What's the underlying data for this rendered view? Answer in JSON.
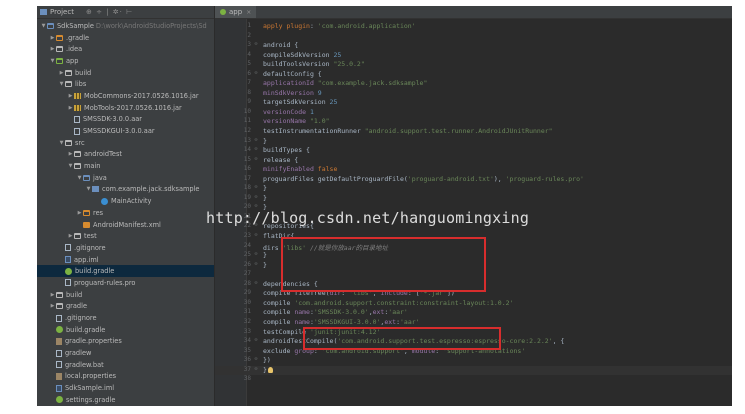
{
  "project_panel": {
    "title": "Project",
    "toolbar_glyphs": "⊕ ÷ | ✲· ⊢",
    "tree": [
      {
        "depth": 0,
        "arrow": "▼",
        "icon": "folder-blue",
        "label": "SdkSample",
        "note": "D:\\work\\AndroidStudioProjects\\Sd"
      },
      {
        "depth": 1,
        "arrow": "▶",
        "icon": "folder-orange",
        "label": ".gradle"
      },
      {
        "depth": 1,
        "arrow": "▶",
        "icon": "folder",
        "label": ".idea"
      },
      {
        "depth": 1,
        "arrow": "▼",
        "icon": "folder-green",
        "label": "app"
      },
      {
        "depth": 2,
        "arrow": "▶",
        "icon": "folder",
        "label": "build"
      },
      {
        "depth": 2,
        "arrow": "▼",
        "icon": "folder",
        "label": "libs"
      },
      {
        "depth": 3,
        "arrow": "▶",
        "icon": "jar",
        "label": "MobCommons-2017.0526.1016.jar"
      },
      {
        "depth": 3,
        "arrow": "▶",
        "icon": "jar",
        "label": "MobTools-2017.0526.1016.jar"
      },
      {
        "depth": 3,
        "arrow": "",
        "icon": "file",
        "label": "SMSSDK-3.0.0.aar"
      },
      {
        "depth": 3,
        "arrow": "",
        "icon": "file",
        "label": "SMSSDKGUI-3.0.0.aar"
      },
      {
        "depth": 2,
        "arrow": "▼",
        "icon": "folder",
        "label": "src"
      },
      {
        "depth": 3,
        "arrow": "▶",
        "icon": "folder",
        "label": "androidTest"
      },
      {
        "depth": 3,
        "arrow": "▼",
        "icon": "folder",
        "label": "main"
      },
      {
        "depth": 4,
        "arrow": "▼",
        "icon": "folder-blue",
        "label": "java"
      },
      {
        "depth": 5,
        "arrow": "▼",
        "icon": "pkg",
        "label": "com.example.jack.sdksample"
      },
      {
        "depth": 6,
        "arrow": "",
        "icon": "cls",
        "label": "MainActivity"
      },
      {
        "depth": 4,
        "arrow": "▶",
        "icon": "folder-orange",
        "label": "res"
      },
      {
        "depth": 4,
        "arrow": "",
        "icon": "xml",
        "label": "AndroidManifest.xml"
      },
      {
        "depth": 3,
        "arrow": "▶",
        "icon": "folder",
        "label": "test"
      },
      {
        "depth": 2,
        "arrow": "",
        "icon": "file",
        "label": ".gitignore"
      },
      {
        "depth": 2,
        "arrow": "",
        "icon": "iml",
        "label": "app.iml"
      },
      {
        "depth": 2,
        "arrow": "",
        "icon": "gradle",
        "label": "build.gradle",
        "selected": true
      },
      {
        "depth": 2,
        "arrow": "",
        "icon": "file",
        "label": "proguard-rules.pro"
      },
      {
        "depth": 1,
        "arrow": "▶",
        "icon": "folder",
        "label": "build"
      },
      {
        "depth": 1,
        "arrow": "▶",
        "icon": "folder",
        "label": "gradle"
      },
      {
        "depth": 1,
        "arrow": "",
        "icon": "file",
        "label": ".gitignore"
      },
      {
        "depth": 1,
        "arrow": "",
        "icon": "gradle",
        "label": "build.gradle"
      },
      {
        "depth": 1,
        "arrow": "",
        "icon": "props",
        "label": "gradle.properties"
      },
      {
        "depth": 1,
        "arrow": "",
        "icon": "file",
        "label": "gradlew"
      },
      {
        "depth": 1,
        "arrow": "",
        "icon": "file",
        "label": "gradlew.bat"
      },
      {
        "depth": 1,
        "arrow": "",
        "icon": "props",
        "label": "local.properties"
      },
      {
        "depth": 1,
        "arrow": "",
        "icon": "iml",
        "label": "SdkSample.iml"
      },
      {
        "depth": 1,
        "arrow": "",
        "icon": "gradle",
        "label": "settings.gradle"
      }
    ]
  },
  "editor": {
    "tab_label": "app",
    "tab_close": "×",
    "lines": [
      {
        "n": "1",
        "code": [
          [
            "k",
            "apply plugin"
          ],
          [
            "d",
            ": "
          ],
          [
            "s",
            "'com.android.application'"
          ]
        ]
      },
      {
        "n": "2",
        "code": []
      },
      {
        "n": "3",
        "fold": "⊖",
        "code": [
          [
            "d",
            "android {"
          ]
        ]
      },
      {
        "n": "4",
        "code": [
          [
            "d",
            "    compileSdkVersion "
          ],
          [
            "n",
            "25"
          ]
        ]
      },
      {
        "n": "5",
        "code": [
          [
            "d",
            "    buildToolsVersion "
          ],
          [
            "s",
            "\"25.0.2\""
          ]
        ]
      },
      {
        "n": "6",
        "fold": "⊖",
        "code": [
          [
            "d",
            "    defaultConfig {"
          ]
        ]
      },
      {
        "n": "7",
        "code": [
          [
            "p",
            "        applicationId "
          ],
          [
            "s",
            "\"com.example.jack.sdksample\""
          ]
        ]
      },
      {
        "n": "8",
        "code": [
          [
            "p",
            "        minSdkVersion "
          ],
          [
            "n",
            "9"
          ]
        ]
      },
      {
        "n": "9",
        "code": [
          [
            "d",
            "        targetSdkVersion "
          ],
          [
            "n",
            "25"
          ]
        ]
      },
      {
        "n": "10",
        "code": [
          [
            "p",
            "        versionCode "
          ],
          [
            "n",
            "1"
          ]
        ]
      },
      {
        "n": "11",
        "code": [
          [
            "p",
            "        versionName "
          ],
          [
            "s",
            "\"1.0\""
          ]
        ]
      },
      {
        "n": "12",
        "code": [
          [
            "d",
            "        testInstrumentationRunner "
          ],
          [
            "s",
            "\"android.support.test.runner.AndroidJUnitRunner\""
          ]
        ]
      },
      {
        "n": "13",
        "fold": "⊖",
        "code": [
          [
            "d",
            "    }"
          ]
        ]
      },
      {
        "n": "14",
        "fold": "⊖",
        "code": [
          [
            "d",
            "    buildTypes {"
          ]
        ]
      },
      {
        "n": "15",
        "fold": "⊖",
        "code": [
          [
            "d",
            "        release {"
          ]
        ]
      },
      {
        "n": "16",
        "code": [
          [
            "p",
            "            minifyEnabled "
          ],
          [
            "k",
            "false"
          ]
        ]
      },
      {
        "n": "17",
        "code": [
          [
            "d",
            "            proguardFiles getDefaultProguardFile("
          ],
          [
            "s",
            "'proguard-android.txt'"
          ],
          [
            "d",
            "), "
          ],
          [
            "s",
            "'proguard-rules.pro'"
          ]
        ]
      },
      {
        "n": "18",
        "fold": "⊖",
        "code": [
          [
            "d",
            "        }"
          ]
        ]
      },
      {
        "n": "19",
        "fold": "⊖",
        "code": [
          [
            "d",
            "    }"
          ]
        ]
      },
      {
        "n": "20",
        "fold": "⊖",
        "code": [
          [
            "d",
            "}"
          ]
        ]
      },
      {
        "n": "21",
        "code": []
      },
      {
        "n": "22",
        "fold": "⊖",
        "code": [
          [
            "d",
            "repositories{"
          ]
        ]
      },
      {
        "n": "23",
        "fold": "⊖",
        "code": [
          [
            "d",
            "    flatDir{"
          ]
        ]
      },
      {
        "n": "24",
        "code": [
          [
            "d",
            "        dirs "
          ],
          [
            "s",
            "'libs'"
          ],
          [
            "d",
            " "
          ],
          [
            "c",
            "//就是你放aar的目录地址"
          ]
        ]
      },
      {
        "n": "25",
        "fold": "⊖",
        "code": [
          [
            "d",
            "    }"
          ]
        ]
      },
      {
        "n": "26",
        "fold": "⊖",
        "code": [
          [
            "d",
            "}"
          ]
        ]
      },
      {
        "n": "27",
        "code": []
      },
      {
        "n": "28",
        "fold": "⊖",
        "code": [
          [
            "d",
            "dependencies {"
          ]
        ]
      },
      {
        "n": "29",
        "code": [
          [
            "d",
            "    compile fileTree("
          ],
          [
            "p",
            "dir"
          ],
          [
            "d",
            ": "
          ],
          [
            "s",
            "'libs'"
          ],
          [
            "d",
            ", "
          ],
          [
            "p",
            "include"
          ],
          [
            "d",
            ": ["
          ],
          [
            "s",
            "'*.jar'"
          ],
          [
            "d",
            "])"
          ]
        ]
      },
      {
        "n": "30",
        "code": [
          [
            "d",
            "    compile "
          ],
          [
            "s",
            "'com.android.support.constraint:constraint-layout:1.0.2'"
          ]
        ]
      },
      {
        "n": "31",
        "code": [
          [
            "d",
            "    compile "
          ],
          [
            "p",
            "name"
          ],
          [
            "d",
            ":"
          ],
          [
            "s",
            "'SMSSDK-3.0.0'"
          ],
          [
            "d",
            ","
          ],
          [
            "p",
            "ext"
          ],
          [
            "d",
            ":"
          ],
          [
            "s",
            "'aar'"
          ]
        ]
      },
      {
        "n": "32",
        "code": [
          [
            "d",
            "    compile "
          ],
          [
            "p",
            "name"
          ],
          [
            "d",
            ":"
          ],
          [
            "s",
            "'SMSSDKGUI-3.0.0'"
          ],
          [
            "d",
            ","
          ],
          [
            "p",
            "ext"
          ],
          [
            "d",
            ":"
          ],
          [
            "s",
            "'aar'"
          ]
        ]
      },
      {
        "n": "33",
        "code": [
          [
            "d",
            "    testCompile "
          ],
          [
            "s",
            "'junit:junit:4.12'"
          ]
        ]
      },
      {
        "n": "34",
        "fold": "⊖",
        "code": [
          [
            "d",
            "    androidTestCompile("
          ],
          [
            "s",
            "'com.android.support.test.espresso:espresso-core:2.2.2'"
          ],
          [
            "d",
            ", {"
          ]
        ]
      },
      {
        "n": "35",
        "code": [
          [
            "d",
            "        exclude "
          ],
          [
            "p",
            "group"
          ],
          [
            "d",
            ": "
          ],
          [
            "s",
            "'com.android.support'"
          ],
          [
            "d",
            ", "
          ],
          [
            "p",
            "module"
          ],
          [
            "d",
            ": "
          ],
          [
            "s",
            "'support-annotations'"
          ]
        ]
      },
      {
        "n": "36",
        "fold": "⊖",
        "code": [
          [
            "d",
            "    })"
          ]
        ]
      },
      {
        "n": "37",
        "fold": "⊖",
        "code": [
          [
            "d",
            "}"
          ]
        ],
        "bulb": true,
        "current": true
      },
      {
        "n": "38",
        "code": []
      }
    ]
  },
  "watermark": "http://blog.csdn.net/hanguomingxing",
  "colors": {
    "editor_bg": "#2b2b2b",
    "panel_bg": "#3c3f41",
    "keyword": "#cc7832",
    "string": "#6a8759",
    "number": "#6897bb",
    "property": "#9876aa",
    "highlight_box": "#d72d2d"
  }
}
